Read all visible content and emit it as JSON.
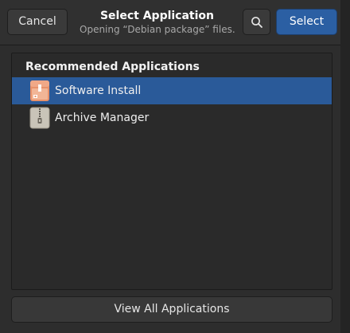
{
  "header": {
    "cancel_label": "Cancel",
    "title": "Select Application",
    "subtitle": "Opening “Debian package” files.",
    "search_icon": "search-icon",
    "select_label": "Select"
  },
  "list": {
    "heading": "Recommended Applications",
    "items": [
      {
        "label": "Software Install",
        "icon": "software-install-icon",
        "selected": true
      },
      {
        "label": "Archive Manager",
        "icon": "archive-manager-icon",
        "selected": false
      }
    ]
  },
  "footer": {
    "view_all_label": "View All Applications"
  },
  "colors": {
    "accent": "#2b5fa3",
    "selection": "#2a5a99",
    "dialog_bg": "#2d2d2d",
    "list_bg": "#2a2a2a"
  }
}
